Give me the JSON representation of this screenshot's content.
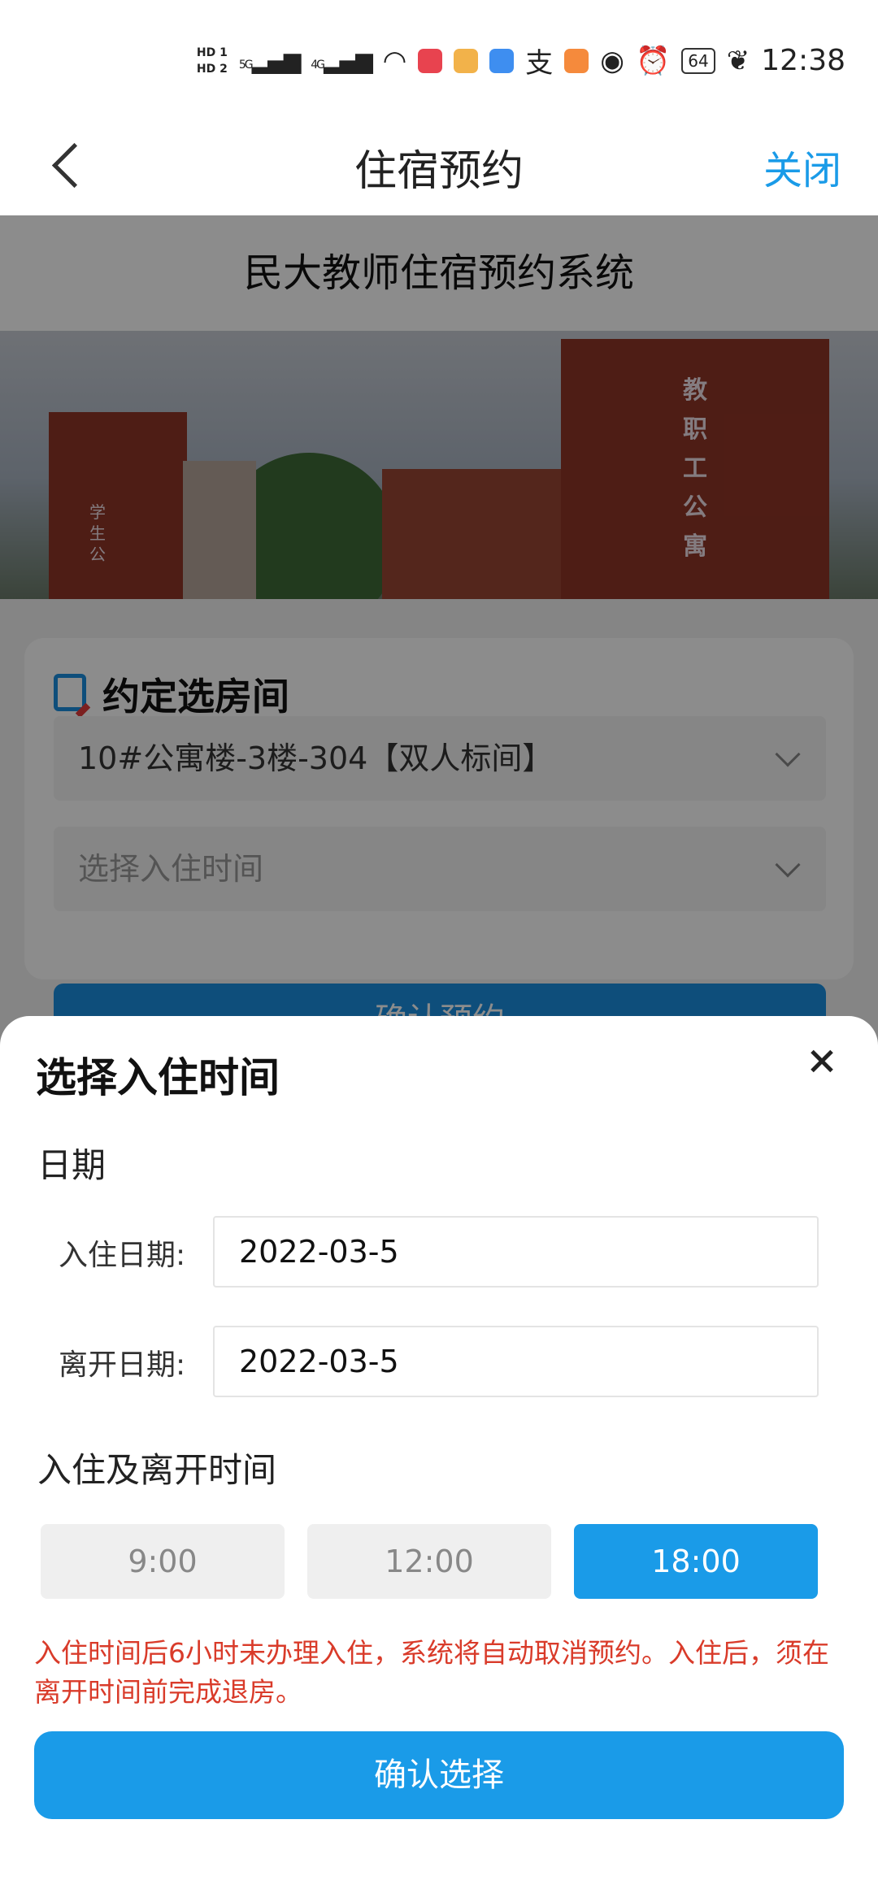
{
  "status_bar": {
    "hd1": "HD 1",
    "hd2": "HD 2",
    "sig1": "5G",
    "sig2": "4G",
    "battery": "64",
    "time": "12:38"
  },
  "nav": {
    "title": "住宿预约",
    "close_label": "关闭"
  },
  "page": {
    "system_title": "民大教师住宿预约系统",
    "hero_sign": "教职工公寓",
    "hero_sign_small": "学生公",
    "card": {
      "title": "约定选房间",
      "room_value": "10#公寓楼-3楼-304【双人标间】",
      "checkin_placeholder": "选择入住时间"
    },
    "confirm_booking_label": "确认预约"
  },
  "sheet": {
    "title": "选择入住时间",
    "date_section_label": "日期",
    "checkin_date_label": "入住日期:",
    "checkin_date_value": "2022-03-5",
    "leave_date_label": "离开日期:",
    "leave_date_value": "2022-03-5",
    "time_section_label": "入住及离开时间",
    "time_options": [
      "9:00",
      "12:00",
      "18:00"
    ],
    "selected_time": "18:00",
    "notice": "入住时间后6小时未办理入住，系统将自动取消预约。入住后，须在离开时间前完成退房。",
    "confirm_label": "确认选择"
  },
  "colors": {
    "accent": "#1a9be8",
    "notice_red": "#d93b2a"
  }
}
